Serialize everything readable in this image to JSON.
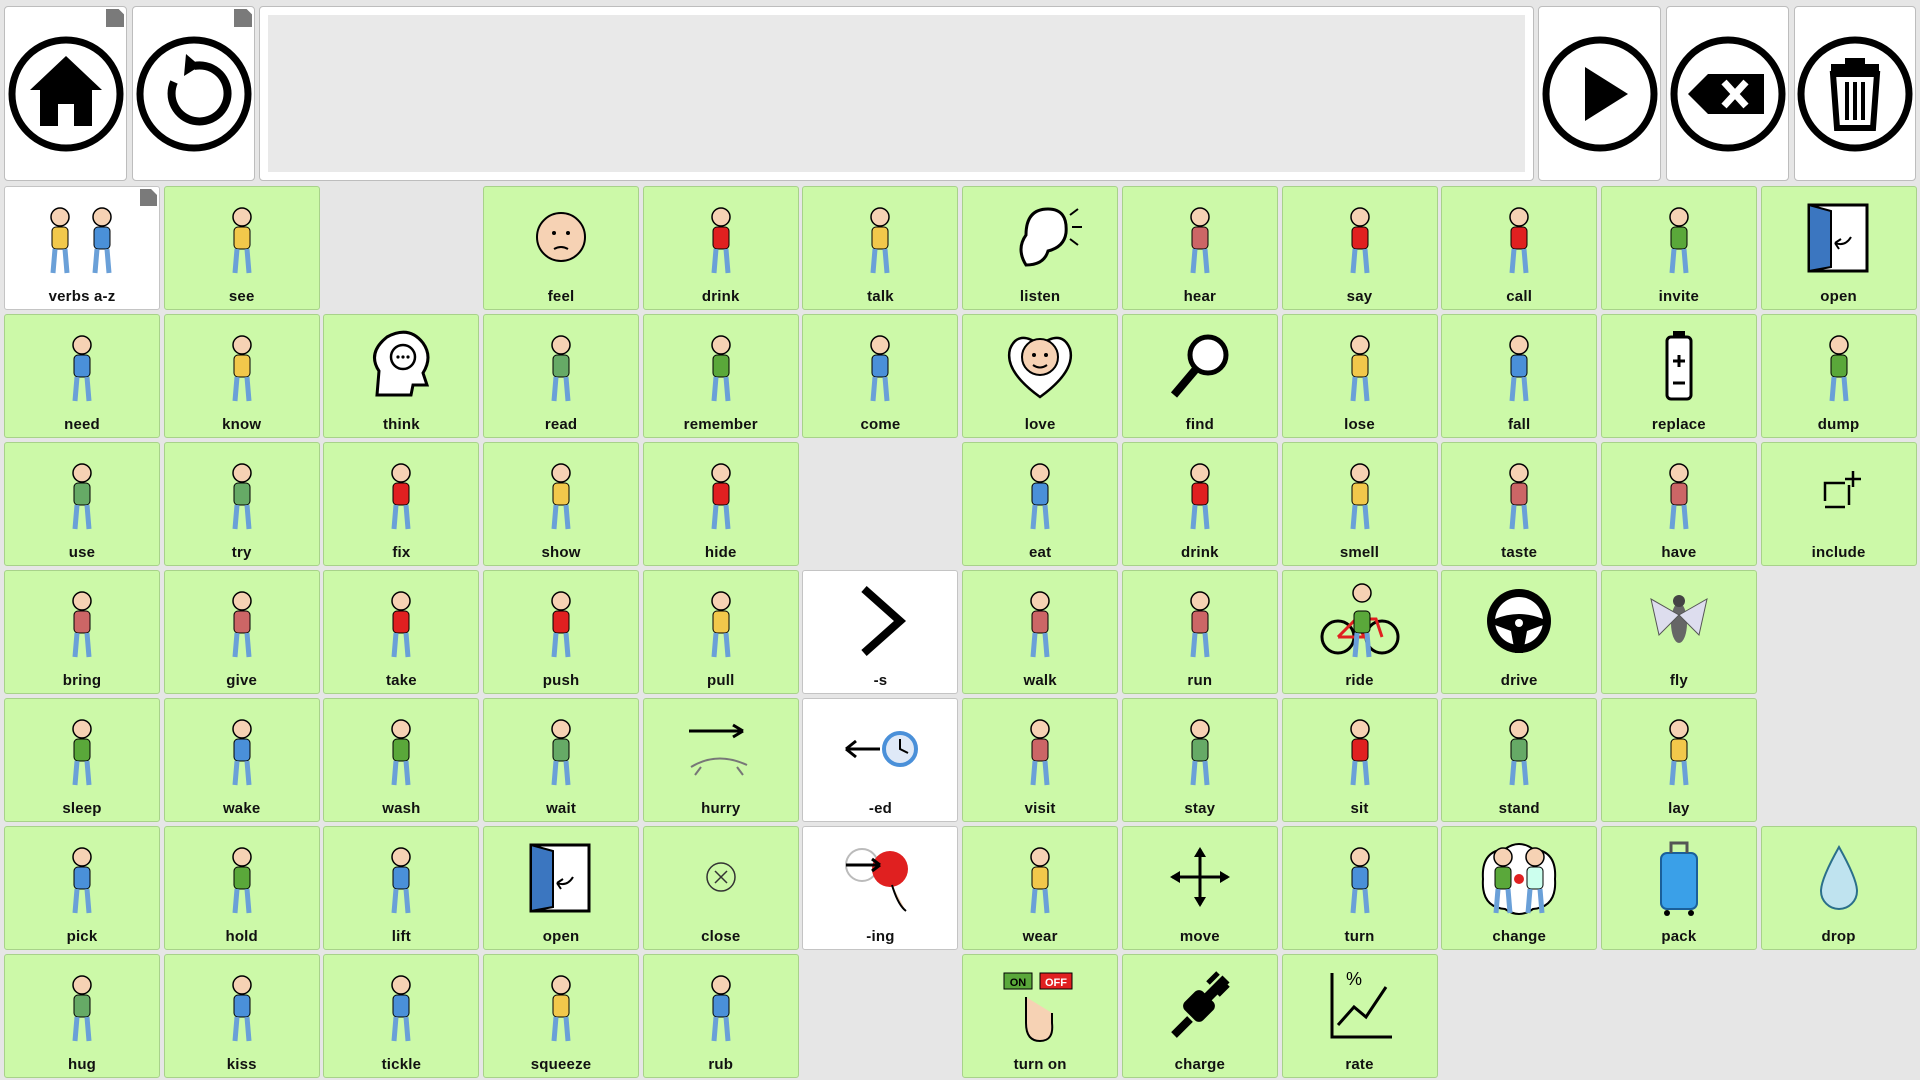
{
  "toolbar": {
    "home": "home",
    "back": "back",
    "speak": "speak",
    "backspace": "backspace",
    "clear": "clear"
  },
  "colors": {
    "cell_green": "#ccf9a8",
    "cell_white": "#ffffff",
    "background": "#e6e6e6"
  },
  "grid": {
    "rows": [
      [
        {
          "label": "verbs a-z",
          "icon": "verbs-a-z-icon",
          "style": "white",
          "corner": true
        },
        {
          "label": "see",
          "icon": "see-icon"
        },
        null,
        {
          "label": "feel",
          "icon": "feel-icon"
        },
        {
          "label": "drink",
          "icon": "drink-icon"
        },
        {
          "label": "talk",
          "icon": "talk-icon"
        },
        {
          "label": "listen",
          "icon": "listen-icon"
        },
        {
          "label": "hear",
          "icon": "hear-icon"
        },
        {
          "label": "say",
          "icon": "say-icon"
        },
        {
          "label": "call",
          "icon": "call-icon"
        },
        {
          "label": "invite",
          "icon": "invite-icon"
        },
        {
          "label": "open",
          "icon": "open-icon"
        }
      ],
      [
        {
          "label": "need",
          "icon": "need-icon"
        },
        {
          "label": "know",
          "icon": "know-icon"
        },
        {
          "label": "think",
          "icon": "think-icon"
        },
        {
          "label": "read",
          "icon": "read-icon"
        },
        {
          "label": "remember",
          "icon": "remember-icon"
        },
        {
          "label": "come",
          "icon": "come-icon"
        },
        {
          "label": "love",
          "icon": "love-icon"
        },
        {
          "label": "find",
          "icon": "find-icon"
        },
        {
          "label": "lose",
          "icon": "lose-icon"
        },
        {
          "label": "fall",
          "icon": "fall-icon"
        },
        {
          "label": "replace",
          "icon": "replace-icon"
        },
        {
          "label": "dump",
          "icon": "dump-icon"
        }
      ],
      [
        {
          "label": "use",
          "icon": "use-icon"
        },
        {
          "label": "try",
          "icon": "try-icon"
        },
        {
          "label": "fix",
          "icon": "fix-icon"
        },
        {
          "label": "show",
          "icon": "show-icon"
        },
        {
          "label": "hide",
          "icon": "hide-icon"
        },
        null,
        {
          "label": "eat",
          "icon": "eat-icon"
        },
        {
          "label": "drink",
          "icon": "drink-icon"
        },
        {
          "label": "smell",
          "icon": "smell-icon"
        },
        {
          "label": "taste",
          "icon": "taste-icon"
        },
        {
          "label": "have",
          "icon": "have-icon"
        },
        {
          "label": "include",
          "icon": "include-icon"
        }
      ],
      [
        {
          "label": "bring",
          "icon": "bring-icon"
        },
        {
          "label": "give",
          "icon": "give-icon"
        },
        {
          "label": "take",
          "icon": "take-icon"
        },
        {
          "label": "push",
          "icon": "push-icon"
        },
        {
          "label": "pull",
          "icon": "pull-icon"
        },
        {
          "label": "-s",
          "icon": "chevron-right-icon",
          "style": "white"
        },
        {
          "label": "walk",
          "icon": "walk-icon"
        },
        {
          "label": "run",
          "icon": "run-icon"
        },
        {
          "label": "ride",
          "icon": "bicycle-icon"
        },
        {
          "label": "drive",
          "icon": "steering-wheel-icon"
        },
        {
          "label": "fly",
          "icon": "fly-icon"
        },
        null
      ],
      [
        {
          "label": "sleep",
          "icon": "sleep-icon"
        },
        {
          "label": "wake",
          "icon": "wake-icon"
        },
        {
          "label": "wash",
          "icon": "wash-icon"
        },
        {
          "label": "wait",
          "icon": "wait-icon"
        },
        {
          "label": "hurry",
          "icon": "hurry-icon"
        },
        {
          "label": "-ed",
          "icon": "past-clock-icon",
          "style": "white"
        },
        {
          "label": "visit",
          "icon": "visit-icon"
        },
        {
          "label": "stay",
          "icon": "stay-icon"
        },
        {
          "label": "sit",
          "icon": "sit-icon"
        },
        {
          "label": "stand",
          "icon": "stand-icon"
        },
        {
          "label": "lay",
          "icon": "lay-icon"
        },
        null
      ],
      [
        {
          "label": "pick",
          "icon": "pick-icon"
        },
        {
          "label": "hold",
          "icon": "hold-icon"
        },
        {
          "label": "lift",
          "icon": "lift-icon"
        },
        {
          "label": "open",
          "icon": "open-icon"
        },
        {
          "label": "close",
          "icon": "close-icon"
        },
        {
          "label": "-ing",
          "icon": "ing-icon",
          "style": "white"
        },
        {
          "label": "wear",
          "icon": "wear-icon"
        },
        {
          "label": "move",
          "icon": "move-icon"
        },
        {
          "label": "turn",
          "icon": "turn-icon"
        },
        {
          "label": "change",
          "icon": "change-icon"
        },
        {
          "label": "pack",
          "icon": "suitcase-icon"
        },
        {
          "label": "drop",
          "icon": "drop-icon"
        }
      ],
      [
        {
          "label": "hug",
          "icon": "hug-icon"
        },
        {
          "label": "kiss",
          "icon": "kiss-icon"
        },
        {
          "label": "tickle",
          "icon": "tickle-icon"
        },
        {
          "label": "squeeze",
          "icon": "squeeze-icon"
        },
        {
          "label": "rub",
          "icon": "rub-icon"
        },
        null,
        {
          "label": "turn on",
          "icon": "switch-on-icon"
        },
        {
          "label": "charge",
          "icon": "plug-icon"
        },
        {
          "label": "rate",
          "icon": "rate-icon"
        },
        null,
        null,
        null
      ]
    ]
  },
  "switch_icon_text": {
    "on": "ON",
    "off": "OFF"
  }
}
